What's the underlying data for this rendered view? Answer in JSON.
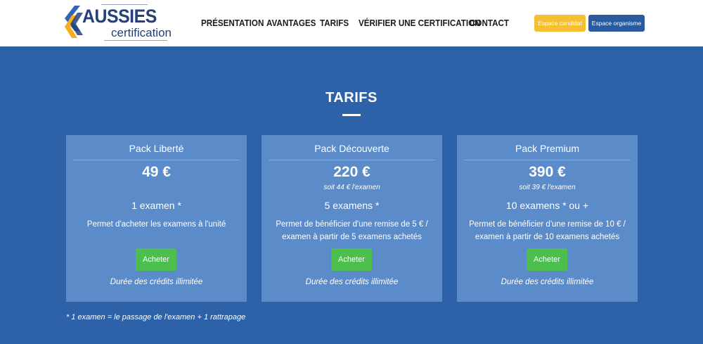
{
  "header": {
    "logo": {
      "title": "AUSSIES",
      "subtitle": "certification"
    },
    "nav": [
      {
        "label": "PRÉSENTATION"
      },
      {
        "label": "AVANTAGES"
      },
      {
        "label": "TARIFS"
      },
      {
        "label": "VÉRIFIER UNE CERTIFICATION"
      },
      {
        "label": "CONTACT"
      }
    ],
    "candidate_button": "Espace candidat",
    "organisation_button": "Espace organisme"
  },
  "pricing": {
    "title": "TARIFS",
    "cards": [
      {
        "name": "Pack Liberté",
        "price": "49 €",
        "per_exam": "",
        "exams": "1 examen *",
        "description": "Permet d'acheter les examens à l'unité",
        "button": "Acheter",
        "note": "Durée des crédits illimitée"
      },
      {
        "name": "Pack Découverte",
        "price": "220 €",
        "per_exam": "soit 44 € l'examen",
        "exams": "5 examens *",
        "description": "Permet de bénéficier d'une remise de 5 € / examen à partir de 5 examens achetés",
        "button": "Acheter",
        "note": "Durée des crédits illimitée"
      },
      {
        "name": "Pack Premium",
        "price": "390 €",
        "per_exam": "soit 39 € l'examen",
        "exams": "10 examens * ou +",
        "description": "Permet de bénéficier d'une remise de 10 € / examen à partir de 10 examens achetés",
        "button": "Acheter",
        "note": "Durée des crédits illimitée"
      }
    ],
    "footnote": "* 1 examen = le passage de l'examen + 1 rattrapage"
  },
  "colors": {
    "background": "#2d62a8",
    "card": "#5b8cc9",
    "buy_button": "#4cbf4e",
    "candidate_button": "#f4c032",
    "organisation_button": "#2a5aa0",
    "logo": "#25407a"
  },
  "icons": {
    "logo_mark": "chevron-arrows-icon"
  }
}
